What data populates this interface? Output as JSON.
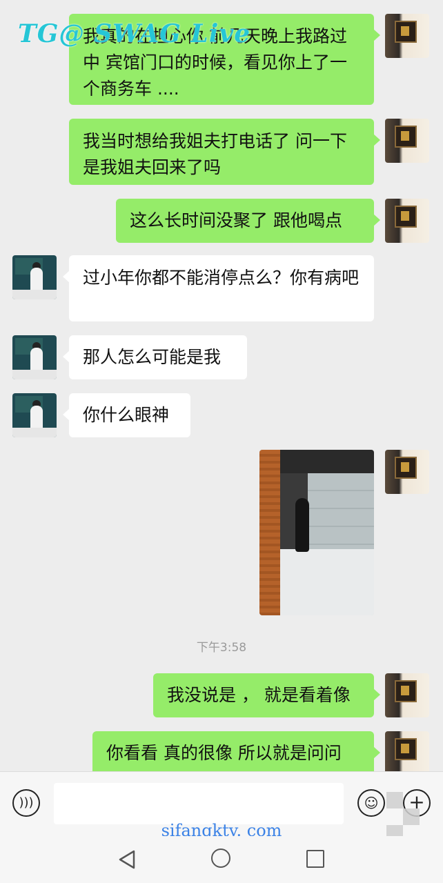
{
  "watermark": {
    "top": "TG@ SWAG Live",
    "site": "sifangktv. com"
  },
  "messages": [
    {
      "side": "me",
      "text": "我真的在担心你 前几天晚上我路过中 宾馆门口的时候，看见你上了一个商务车 ...."
    },
    {
      "side": "me",
      "text": "我当时想给我姐夫打电话了 问一下是我姐夫回来了吗"
    },
    {
      "side": "me",
      "text": "这么长时间没聚了 跟他喝点"
    },
    {
      "side": "other",
      "text": "过小年你都不能消停点么？你有病吧"
    },
    {
      "side": "other",
      "text": "那人怎么可能是我"
    },
    {
      "side": "other",
      "text": "你什么眼神"
    },
    {
      "side": "me",
      "type": "image",
      "description": "corridor-photo"
    },
    {
      "side": "me",
      "text": "我没说是 ， 就是看着像"
    },
    {
      "side": "me",
      "text": "你看看 真的很像 所以就是问问"
    }
  ],
  "timestamp": "下午3:58",
  "input": {
    "placeholder": "",
    "voice_icon": "voice-icon",
    "emoji_icon": "emoji-icon",
    "plus_icon": "plus-icon"
  },
  "navbar": {
    "back_icon": "back-triangle-icon",
    "home_icon": "home-circle-icon",
    "recent_icon": "recent-square-icon"
  },
  "colors": {
    "me_bubble": "#95ec69",
    "other_bubble": "#ffffff",
    "background": "#ededed"
  }
}
